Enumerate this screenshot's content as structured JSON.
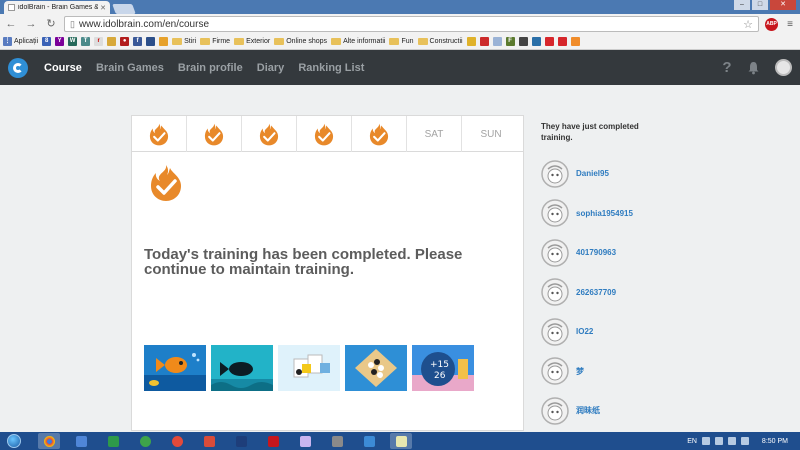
{
  "browser": {
    "tab_title": "idolBrain - Brain Games &",
    "url": "www.idolbrain.com/en/course",
    "bookmarks": {
      "apps_label": "Aplicații",
      "folders": [
        "Stiri",
        "Firme",
        "Exterior",
        "Online shops",
        "Alte informatii",
        "Fun",
        "Constructii"
      ]
    }
  },
  "site": {
    "nav": [
      "Course",
      "Brain Games",
      "Brain profile",
      "Diary",
      "Ranking List"
    ],
    "header_help": "?",
    "brand_color": "#34393d",
    "accent_color": "#2f7cc0",
    "flame_color": "#e8892a"
  },
  "week": [
    {
      "completed": true,
      "label": ""
    },
    {
      "completed": true,
      "label": ""
    },
    {
      "completed": true,
      "label": ""
    },
    {
      "completed": true,
      "label": ""
    },
    {
      "completed": true,
      "label": ""
    },
    {
      "completed": false,
      "label": "SAT"
    },
    {
      "completed": false,
      "label": "SUN"
    }
  ],
  "main": {
    "message": "Today's training has been completed. Please continue to maintain training."
  },
  "sidebar": {
    "title": "They have just completed training.",
    "users": [
      "Daniel95",
      "sophia1954915",
      "401790963",
      "262637709",
      "IO22",
      "梦",
      "润昧纸"
    ]
  },
  "taskbar": {
    "language": "EN",
    "time": "8:50 PM"
  }
}
